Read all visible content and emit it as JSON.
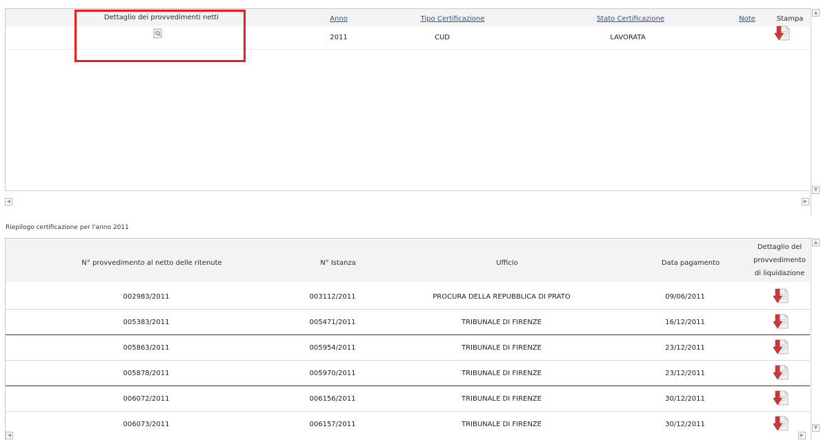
{
  "top_grid": {
    "columns": {
      "detail": "Dettaglio dei provvedimenti netti",
      "year": "Anno",
      "cert_type": "Tipo Certificazione",
      "cert_status": "Stato Certificazione",
      "notes": "Note",
      "print": "Stampa"
    },
    "row": {
      "year": "2011",
      "cert_type": "CUD",
      "cert_status": "LAVORATA"
    }
  },
  "summary_title": "Riepilogo certificazione per l'anno 2011",
  "bottom_grid": {
    "columns": {
      "provision": "N° provvedimento al netto delle ritenute",
      "request": "N° Istanza",
      "office": "Ufficio",
      "payment_date": "Data pagamento",
      "detail_l1": "Dettaglio del",
      "detail_l2": "provvedimento",
      "detail_l3": "di liquidazione"
    },
    "rows": [
      {
        "provision": "002983/2011",
        "request": "003112/2011",
        "office": "PROCURA DELLA REPUBBLICA DI PRATO",
        "date": "09/06/2011"
      },
      {
        "provision": "005383/2011",
        "request": "005471/2011",
        "office": "TRIBUNALE DI FIRENZE",
        "date": "16/12/2011"
      },
      {
        "provision": "005863/2011",
        "request": "005954/2011",
        "office": "TRIBUNALE DI FIRENZE",
        "date": "23/12/2011"
      },
      {
        "provision": "005878/2011",
        "request": "005970/2011",
        "office": "TRIBUNALE DI FIRENZE",
        "date": "23/12/2011"
      },
      {
        "provision": "006072/2011",
        "request": "006156/2011",
        "office": "TRIBUNALE DI FIRENZE",
        "date": "30/12/2011"
      },
      {
        "provision": "006073/2011",
        "request": "006157/2011",
        "office": "TRIBUNALE DI FIRENZE",
        "date": "30/12/2011"
      }
    ]
  },
  "icons": {
    "detail": "magnifier-document-icon",
    "print": "pdf-download-icon",
    "scroll_left": "scroll-left-arrow",
    "scroll_right": "scroll-right-arrow",
    "scroll_up": "scroll-up-arrow",
    "scroll_down": "scroll-down-arrow"
  },
  "colors": {
    "highlight": "#e81c1c",
    "link": "#2b4f8a",
    "header_bg": "#f3f3f3",
    "row_separator_dark": "#1e3a5f"
  }
}
